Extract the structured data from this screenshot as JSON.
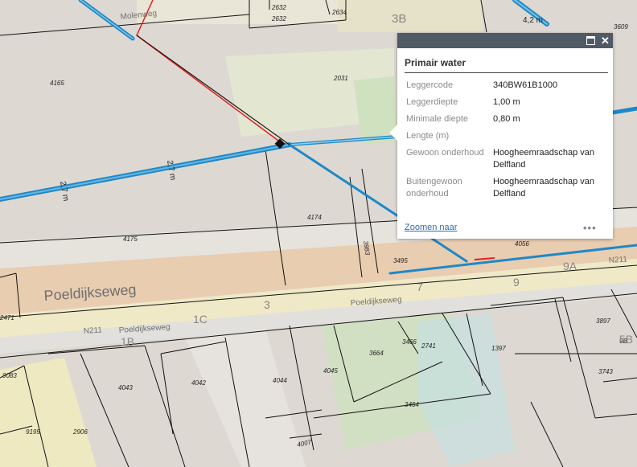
{
  "map": {
    "parcels": [
      "2632",
      "2634",
      "4165",
      "2031",
      "4174",
      "4175",
      "3983",
      "3495",
      "4056",
      "2471",
      "3664",
      "3466",
      "2741",
      "1397",
      "3897",
      "3743",
      "9083",
      "4043",
      "4042",
      "4044",
      "4045",
      "3464",
      "9195",
      "2906",
      "4007",
      "3609",
      "9B"
    ],
    "streets": [
      "Poeldijkseweg",
      "Poeldijkseweg",
      "Poeldijkseweg",
      "Molenweg",
      "N211",
      "N211"
    ],
    "house_numbers": [
      "3B",
      "9A",
      "9",
      "7",
      "3",
      "1C",
      "1B",
      "5B"
    ],
    "measures": [
      "4,2 m",
      "2,7 m",
      "2,7 m"
    ]
  },
  "popup": {
    "title": "Primair water",
    "rows": [
      {
        "label": "Leggercode",
        "value": "340BW61B1000"
      },
      {
        "label": "Leggerdiepte",
        "value": "1,00 m"
      },
      {
        "label": "Minimale diepte",
        "value": "0,80 m"
      },
      {
        "label": "Lengte (m)",
        "value": ""
      },
      {
        "label": "Gewoon onderhoud",
        "value": "Hoogheemraadschap van Delfland"
      },
      {
        "label": "Buitengewoon onderhoud",
        "value": "Hoogheemraadschap van Delfland"
      }
    ],
    "zoom_label": "Zoomen naar",
    "more_label": "•••",
    "close_label": "✕"
  },
  "colors": {
    "background": "#ddd9d2",
    "water_line": "#1e88c8",
    "selected_line": "#e02020",
    "green_area": "#cfe1bf",
    "orange_band": "#ecc9a8"
  }
}
